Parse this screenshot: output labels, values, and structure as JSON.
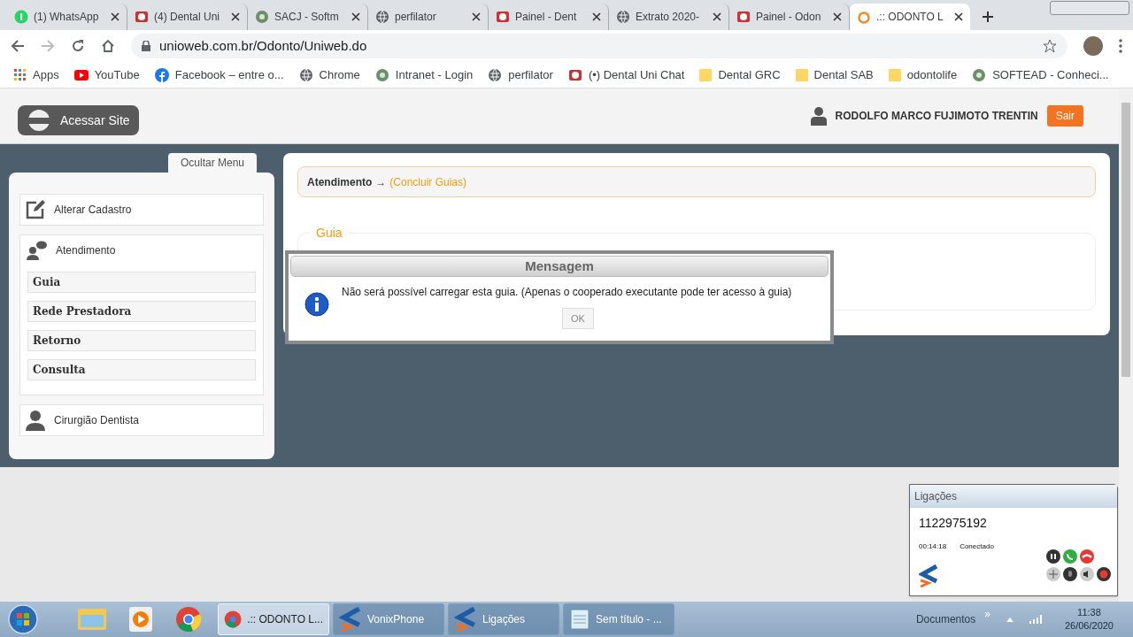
{
  "browser": {
    "tabs": [
      {
        "title": "(1) WhatsApp",
        "kind": "chat",
        "selected": false
      },
      {
        "title": "(4) Dental Uni",
        "kind": "badge",
        "selected": false
      },
      {
        "title": "SACJ - Softm",
        "kind": "logo",
        "selected": false
      },
      {
        "title": "perfilator",
        "kind": "globe",
        "selected": false
      },
      {
        "title": "Painel - Dent",
        "kind": "badge",
        "selected": false
      },
      {
        "title": "Extrato 2020-",
        "kind": "globe",
        "selected": false
      },
      {
        "title": "Painel - Odon",
        "kind": "badge",
        "selected": false
      },
      {
        "title": ".:: ODONTO L",
        "kind": "site",
        "selected": true
      }
    ],
    "address": "unioweb.com.br/Odonto/Uniweb.do",
    "bookmarks": [
      {
        "label": "Apps",
        "kind": "apps"
      },
      {
        "label": "YouTube",
        "kind": "video"
      },
      {
        "label": "Facebook – entre o...",
        "kind": "social"
      },
      {
        "label": "Chrome",
        "kind": "globe"
      },
      {
        "label": "Intranet - Login",
        "kind": "logo"
      },
      {
        "label": "perfilator",
        "kind": "globe"
      },
      {
        "label": "(•) Dental Uni Chat",
        "kind": "badge"
      },
      {
        "label": "Dental GRC",
        "kind": "folder"
      },
      {
        "label": "Dental SAB",
        "kind": "folder"
      },
      {
        "label": "odontolife",
        "kind": "folder"
      },
      {
        "label": "SOFTEAD - Conheci...",
        "kind": "logo"
      }
    ]
  },
  "header": {
    "site_button": "Acessar Site",
    "user": "RODOLFO MARCO FUJIMOTO TRENTIN",
    "logout": "Sair"
  },
  "sidebar": {
    "toggle": "Ocultar Menu",
    "sections": [
      {
        "label": "Alterar Cadastro",
        "kind": "edit",
        "expanded": false
      },
      {
        "label": "Atendimento",
        "kind": "chat",
        "expanded": true,
        "items": [
          "Guia",
          "Rede Prestadora",
          "Retorno",
          "Consulta"
        ]
      },
      {
        "label": "Cirurgião Dentista",
        "kind": "person",
        "expanded": false
      }
    ]
  },
  "breadcrumb": {
    "root": "Atendimento",
    "arrow": "→",
    "current": "(Concluir Guias)"
  },
  "fieldset": {
    "legend": "Guia"
  },
  "dialog": {
    "title": "Mensagem",
    "message": "Não será possível carregar esta guia. (Apenas o cooperado executante pode ter acesso à guia)",
    "button": "OK"
  },
  "phone": {
    "title": "Ligações",
    "number": "1122975192",
    "time": "00:14:18",
    "status": "Conectado"
  },
  "taskbar": {
    "windows": [
      {
        "label": ".:: ODONTO L...",
        "kind": "browser",
        "selected": true
      },
      {
        "label": "VonixPhone",
        "kind": "phone",
        "selected": false
      },
      {
        "label": "Ligações",
        "kind": "phone",
        "selected": false
      },
      {
        "label": "Sem título - ...",
        "kind": "notepad",
        "selected": false
      }
    ],
    "toolbar": "Documentos",
    "more": "»",
    "time": "11:38",
    "date": "26/06/2020"
  }
}
